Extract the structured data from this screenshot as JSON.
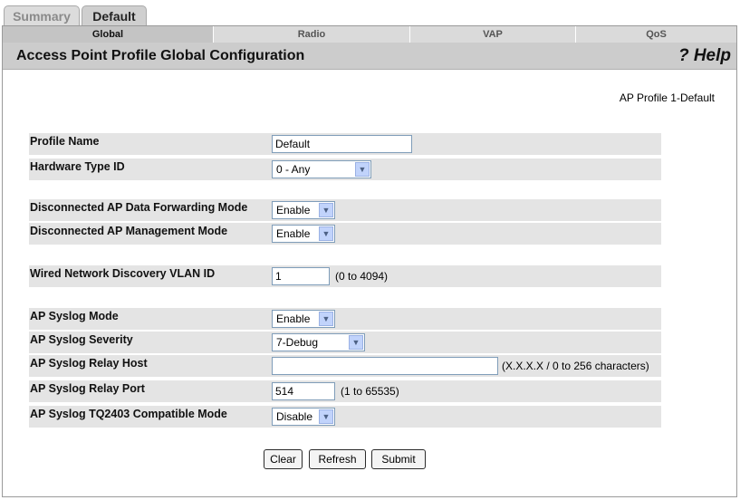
{
  "tabs": [
    {
      "label": "Summary"
    },
    {
      "label": "Default"
    }
  ],
  "subtabs": [
    {
      "label": "Global"
    },
    {
      "label": "Radio"
    },
    {
      "label": "VAP"
    },
    {
      "label": "QoS"
    }
  ],
  "header": {
    "title": "Access Point Profile Global Configuration",
    "help": "? Help"
  },
  "profile_id": "AP Profile 1-Default",
  "fields": {
    "profile_name": {
      "label": "Profile Name",
      "value": "Default"
    },
    "hardware_type": {
      "label": "Hardware Type ID",
      "value": "0 - Any"
    },
    "disc_forwarding": {
      "label": "Disconnected AP Data Forwarding Mode",
      "value": "Enable"
    },
    "disc_management": {
      "label": "Disconnected AP Management Mode",
      "value": "Enable"
    },
    "wired_vlan": {
      "label": "Wired Network Discovery VLAN ID",
      "value": "1",
      "hint": "(0 to 4094)"
    },
    "syslog_mode": {
      "label": "AP Syslog Mode",
      "value": "Enable"
    },
    "syslog_severity": {
      "label": "AP Syslog Severity",
      "value": "7-Debug"
    },
    "syslog_host": {
      "label": "AP Syslog Relay Host",
      "value": "",
      "hint": "(X.X.X.X / 0 to 256 characters)"
    },
    "syslog_port": {
      "label": "AP Syslog Relay Port",
      "value": "514",
      "hint": "(1 to 65535)"
    },
    "syslog_compat": {
      "label": "AP Syslog TQ2403 Compatible Mode",
      "value": "Disable"
    }
  },
  "buttons": {
    "clear": "Clear",
    "refresh": "Refresh",
    "submit": "Submit"
  }
}
